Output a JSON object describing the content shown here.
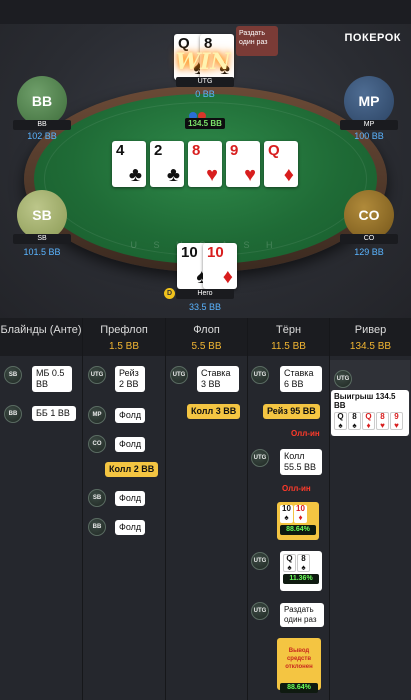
{
  "brand": {
    "logo": "ПОКЕРОК"
  },
  "table": {
    "felt_text": "U S H C A S H",
    "win_text": "WIN",
    "chat_bubble": "Раздать один раз",
    "pot": "134.5 BB",
    "board": [
      {
        "rank": "4",
        "suit": "♣",
        "color": "black"
      },
      {
        "rank": "2",
        "suit": "♣",
        "color": "black"
      },
      {
        "rank": "8",
        "suit": "♥",
        "color": "red"
      },
      {
        "rank": "9",
        "suit": "♥",
        "color": "red"
      },
      {
        "rank": "Q",
        "suit": "♦",
        "color": "red"
      }
    ],
    "utg": {
      "label": "UTG",
      "stack": "0 BB",
      "cards": [
        {
          "rank": "Q",
          "suit": "♠",
          "color": "black"
        },
        {
          "rank": "8",
          "suit": "♠",
          "color": "black"
        }
      ]
    },
    "bb": {
      "avatar": "BB",
      "label": "BB",
      "stack": "102 BB"
    },
    "mp": {
      "avatar": "MP",
      "label": "MP",
      "stack": "100 BB"
    },
    "sb": {
      "avatar": "SB",
      "label": "SB",
      "stack": "101.5 BB"
    },
    "co": {
      "avatar": "CO",
      "label": "CO",
      "stack": "129 BB"
    },
    "hero": {
      "label": "Hero",
      "stack": "33.5 BB",
      "dealer": "D",
      "cards": [
        {
          "rank": "10",
          "suit": "♠",
          "color": "black"
        },
        {
          "rank": "10",
          "suit": "♦",
          "color": "red"
        }
      ]
    }
  },
  "history": {
    "columns": [
      {
        "street": "Блайнды (Анте)",
        "pot": ""
      },
      {
        "street": "Префлоп",
        "pot": "1.5 BB"
      },
      {
        "street": "Флоп",
        "pot": "5.5 BB"
      },
      {
        "street": "Тёрн",
        "pot": "11.5 BB"
      },
      {
        "street": "Ривер",
        "pot": "134.5 BB"
      }
    ],
    "blinds": [
      {
        "pos": "SB",
        "text": "МБ 0.5 BB"
      },
      {
        "pos": "BB",
        "text": "ББ 1 BB"
      }
    ],
    "preflop": [
      {
        "pos": "UTG",
        "text": "Рейз 2 BB"
      },
      {
        "pos": "MP",
        "text": "Фолд"
      },
      {
        "pos": "CO",
        "text": "Фолд"
      },
      {
        "pos": "",
        "text": "Колл 2 BB"
      },
      {
        "pos": "SB",
        "text": "Фолд"
      },
      {
        "pos": "BB",
        "text": "Фолд"
      }
    ],
    "flop": [
      {
        "pos": "UTG",
        "text": "Ставка 3 BB"
      },
      {
        "pos": "",
        "text": "Колл 3 BB"
      }
    ],
    "turn": [
      {
        "pos": "UTG",
        "text": "Ставка 6 BB"
      },
      {
        "pos": "",
        "text": "Рейз 95 BB"
      },
      {
        "pos": "",
        "text": "Олл-ин"
      },
      {
        "pos": "UTG",
        "text": "Колл 55.5 BB"
      },
      {
        "pos": "",
        "text": "Олл-ин"
      },
      {
        "pos": "",
        "equity": "88.64%",
        "cards": [
          {
            "rank": "10",
            "suit": "♠",
            "color": "black"
          },
          {
            "rank": "10",
            "suit": "♦",
            "color": "red"
          }
        ]
      },
      {
        "pos": "UTG",
        "equity": "11.36%",
        "cards": [
          {
            "rank": "Q",
            "suit": "♠",
            "color": "black"
          },
          {
            "rank": "8",
            "suit": "♠",
            "color": "black"
          }
        ]
      },
      {
        "pos": "UTG",
        "text": "Раздать один раз"
      },
      {
        "pos": "",
        "text": "Вывод средств отклонен",
        "equity": "88.64%"
      }
    ],
    "river": {
      "pos": "UTG",
      "win_text": "Выигрыш 134.5 BB",
      "cards": [
        {
          "rank": "Q",
          "suit": "♠",
          "color": "black"
        },
        {
          "rank": "8",
          "suit": "♠",
          "color": "black"
        },
        {
          "rank": "Q",
          "suit": "♦",
          "color": "red"
        },
        {
          "rank": "8",
          "suit": "♥",
          "color": "red"
        },
        {
          "rank": "9",
          "suit": "♥",
          "color": "red"
        }
      ]
    }
  }
}
